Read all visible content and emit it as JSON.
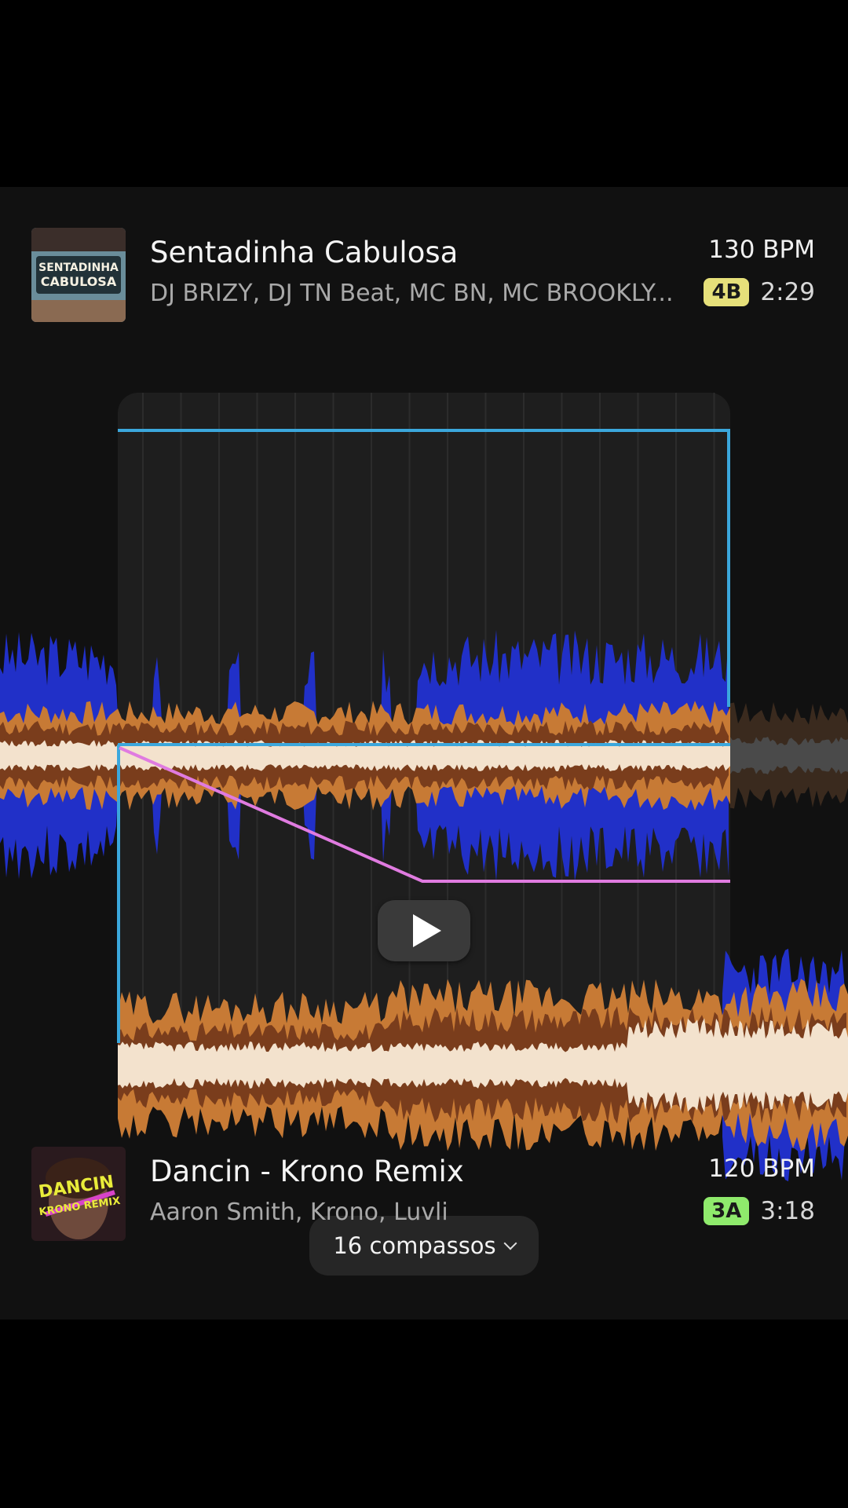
{
  "top_track": {
    "title": "Sentadinha Cabulosa",
    "artists": "DJ BRIZY, DJ TN Beat, MC BN, MC BROOKLY...",
    "bpm": "130 BPM",
    "key": "4B",
    "key_color": "#e6e07a",
    "duration": "2:29",
    "art_text": "SENTADINHA CABULOSA"
  },
  "transition": {
    "bars_label": "16 compassos",
    "play_icon": "play-icon",
    "chevron_icon": "chevron-down-icon",
    "colors": {
      "frame": "#3ba7dc",
      "low": "#2130c8",
      "mid": "#c77a35",
      "mid_dark": "#7a3d1c",
      "high": "#f3e2cd",
      "fade_line": "#e07be0"
    }
  },
  "bottom_track": {
    "title": "Dancin - Krono Remix",
    "artists": "Aaron Smith, Krono, Luvli",
    "bpm": "120 BPM",
    "key": "3A",
    "key_color": "#8fea6c",
    "duration": "3:18",
    "art_text": "DANCIN KRONO REMIX"
  }
}
